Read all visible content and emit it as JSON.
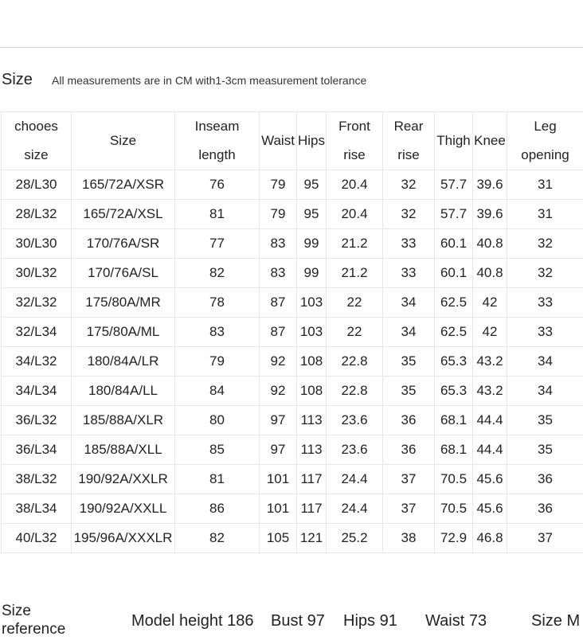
{
  "header": {
    "title": "Size",
    "note": "All measurements are in CM with1-3cm measurement tolerance"
  },
  "table": {
    "columns": [
      {
        "lines": [
          "chooes",
          "size"
        ]
      },
      {
        "lines": [
          "Size"
        ]
      },
      {
        "lines": [
          "Inseam",
          "length"
        ]
      },
      {
        "lines": [
          "Waist"
        ]
      },
      {
        "lines": [
          "Hips"
        ]
      },
      {
        "lines": [
          "Front",
          "rise"
        ]
      },
      {
        "lines": [
          "Rear",
          "rise"
        ]
      },
      {
        "lines": [
          "Thigh"
        ]
      },
      {
        "lines": [
          "Knee"
        ]
      },
      {
        "lines": [
          "Leg",
          "opening"
        ]
      }
    ],
    "rows": [
      [
        "28/L30",
        "165/72A/XSR",
        "76",
        "79",
        "95",
        "20.4",
        "32",
        "57.7",
        "39.6",
        "31"
      ],
      [
        "28/L32",
        "165/72A/XSL",
        "81",
        "79",
        "95",
        "20.4",
        "32",
        "57.7",
        "39.6",
        "31"
      ],
      [
        "30/L30",
        "170/76A/SR",
        "77",
        "83",
        "99",
        "21.2",
        "33",
        "60.1",
        "40.8",
        "32"
      ],
      [
        "30/L32",
        "170/76A/SL",
        "82",
        "83",
        "99",
        "21.2",
        "33",
        "60.1",
        "40.8",
        "32"
      ],
      [
        "32/L32",
        "175/80A/MR",
        "78",
        "87",
        "103",
        "22",
        "34",
        "62.5",
        "42",
        "33"
      ],
      [
        "32/L34",
        "175/80A/ML",
        "83",
        "87",
        "103",
        "22",
        "34",
        "62.5",
        "42",
        "33"
      ],
      [
        "34/L32",
        "180/84A/LR",
        "79",
        "92",
        "108",
        "22.8",
        "35",
        "65.3",
        "43.2",
        "34"
      ],
      [
        "34/L34",
        "180/84A/LL",
        "84",
        "92",
        "108",
        "22.8",
        "35",
        "65.3",
        "43.2",
        "34"
      ],
      [
        "36/L32",
        "185/88A/XLR",
        "80",
        "97",
        "113",
        "23.6",
        "36",
        "68.1",
        "44.4",
        "35"
      ],
      [
        "36/L34",
        "185/88A/XLL",
        "85",
        "97",
        "113",
        "23.6",
        "36",
        "68.1",
        "44.4",
        "35"
      ],
      [
        "38/L32",
        "190/92A/XXLR",
        "81",
        "101",
        "117",
        "24.4",
        "37",
        "70.5",
        "45.6",
        "36"
      ],
      [
        "38/L34",
        "190/92A/XXLL",
        "86",
        "101",
        "117",
        "24.4",
        "37",
        "70.5",
        "45.6",
        "36"
      ],
      [
        "40/L32",
        "195/96A/XXXLR",
        "82",
        "105",
        "121",
        "25.2",
        "38",
        "72.9",
        "46.8",
        "37"
      ]
    ]
  },
  "reference": {
    "label_lines": [
      "Size",
      "reference"
    ],
    "model_height": "Model height 186",
    "bust": "Bust 97",
    "hips": "Hips 91",
    "waist": "Waist 73",
    "size": "Size M"
  }
}
